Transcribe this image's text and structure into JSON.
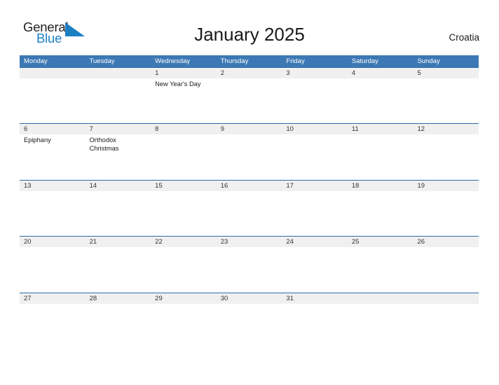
{
  "brand": {
    "word_one": "General",
    "word_two": "Blue",
    "flag_icon": "blue-triangle-flag-icon",
    "word_one_color": "#231f20",
    "word_two_color": "#1b7fc4",
    "flag_color": "#1b7fc4"
  },
  "header": {
    "title": "January 2025",
    "country": "Croatia"
  },
  "colors": {
    "header_blue": "#3c78b4",
    "row_divider_blue": "#2c6ca8",
    "number_band_gray": "#f0f0f0",
    "page_background": "#ffffff",
    "text_dark": "#1a1a1a"
  },
  "calendar": {
    "month": "January",
    "year": "2025",
    "weekdays": [
      "Monday",
      "Tuesday",
      "Wednesday",
      "Thursday",
      "Friday",
      "Saturday",
      "Sunday"
    ],
    "weeks": [
      {
        "days": [
          {
            "number": "",
            "event": ""
          },
          {
            "number": "",
            "event": ""
          },
          {
            "number": "1",
            "event": "New Year's Day"
          },
          {
            "number": "2",
            "event": ""
          },
          {
            "number": "3",
            "event": ""
          },
          {
            "number": "4",
            "event": ""
          },
          {
            "number": "5",
            "event": ""
          }
        ]
      },
      {
        "days": [
          {
            "number": "6",
            "event": "Epiphany"
          },
          {
            "number": "7",
            "event": "Orthodox Christmas"
          },
          {
            "number": "8",
            "event": ""
          },
          {
            "number": "9",
            "event": ""
          },
          {
            "number": "10",
            "event": ""
          },
          {
            "number": "11",
            "event": ""
          },
          {
            "number": "12",
            "event": ""
          }
        ]
      },
      {
        "days": [
          {
            "number": "13",
            "event": ""
          },
          {
            "number": "14",
            "event": ""
          },
          {
            "number": "15",
            "event": ""
          },
          {
            "number": "16",
            "event": ""
          },
          {
            "number": "17",
            "event": ""
          },
          {
            "number": "18",
            "event": ""
          },
          {
            "number": "19",
            "event": ""
          }
        ]
      },
      {
        "days": [
          {
            "number": "20",
            "event": ""
          },
          {
            "number": "21",
            "event": ""
          },
          {
            "number": "22",
            "event": ""
          },
          {
            "number": "23",
            "event": ""
          },
          {
            "number": "24",
            "event": ""
          },
          {
            "number": "25",
            "event": ""
          },
          {
            "number": "26",
            "event": ""
          }
        ]
      },
      {
        "days": [
          {
            "number": "27",
            "event": ""
          },
          {
            "number": "28",
            "event": ""
          },
          {
            "number": "29",
            "event": ""
          },
          {
            "number": "30",
            "event": ""
          },
          {
            "number": "31",
            "event": ""
          },
          {
            "number": "",
            "event": ""
          },
          {
            "number": "",
            "event": ""
          }
        ]
      }
    ]
  }
}
